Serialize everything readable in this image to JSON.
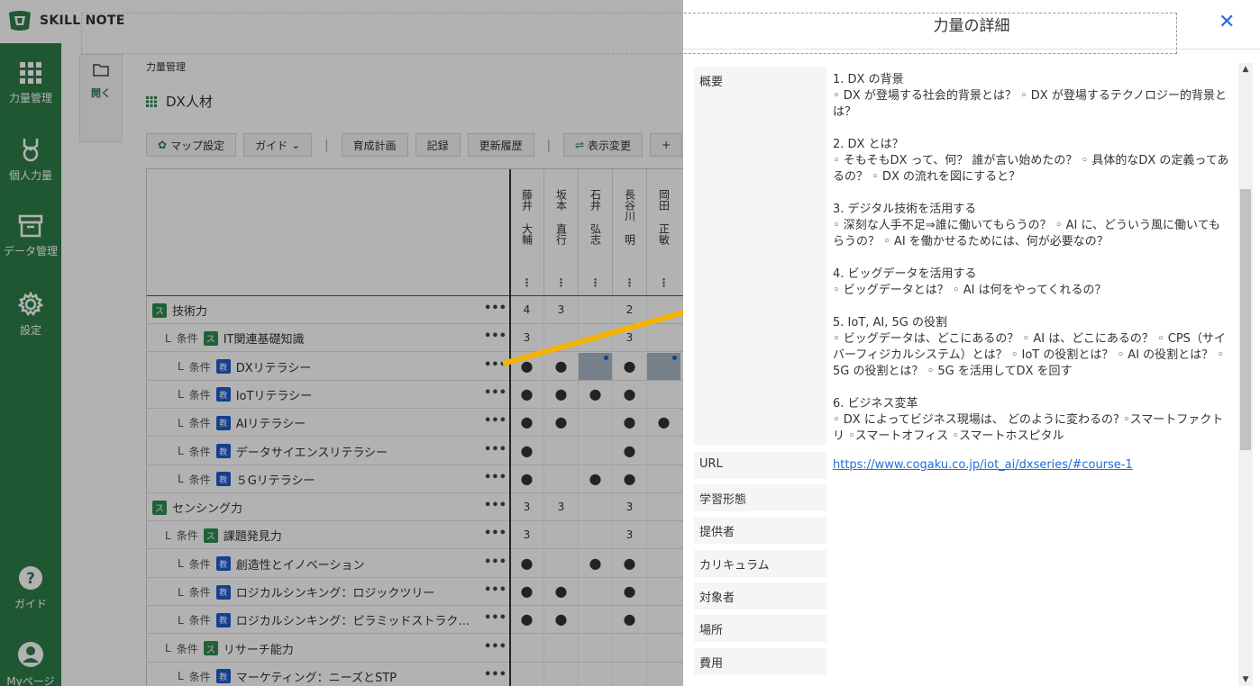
{
  "app": {
    "logo_text": "SKILL NOTE"
  },
  "sidenav": {
    "items": [
      {
        "label": "力量管理",
        "icon": "grid-icon"
      },
      {
        "label": "個人力量",
        "icon": "medal-icon"
      },
      {
        "label": "データ管理",
        "icon": "archive-icon"
      },
      {
        "label": "設定",
        "icon": "gear-icon"
      }
    ],
    "bottom": [
      {
        "label": "ガイド",
        "icon": "help-icon"
      },
      {
        "label": "Myページ",
        "icon": "user-icon"
      }
    ]
  },
  "main": {
    "open_label": "開く",
    "breadcrumb": "力量管理",
    "title": "DX人材",
    "toolbar": {
      "map_settings": "マップ設定",
      "guide": "ガイド",
      "training_plan": "育成計画",
      "record": "記録",
      "history": "更新履歴",
      "display_change": "表示変更",
      "separator": "|"
    },
    "people": [
      {
        "name": "藤井 大輔"
      },
      {
        "name": "坂本 直行"
      },
      {
        "name": "石井 弘志"
      },
      {
        "name": "長谷川 明"
      },
      {
        "name": "岡田 正敏"
      }
    ],
    "rows": [
      {
        "depth": 0,
        "prefix": "",
        "cond": "",
        "badge": "ス",
        "badge_type": "s",
        "label": "技術力",
        "cells": [
          "4",
          "3",
          "",
          "2",
          ""
        ]
      },
      {
        "depth": 1,
        "prefix": "L",
        "cond": "条件",
        "badge": "ス",
        "badge_type": "s",
        "label": "IT関連基礎知識",
        "cells": [
          "3",
          "",
          "",
          "3",
          ""
        ]
      },
      {
        "depth": 2,
        "prefix": "L",
        "cond": "条件",
        "badge": "教",
        "badge_type": "k",
        "label": "DXリテラシー",
        "cells": [
          "●",
          "●",
          "",
          "●",
          ""
        ]
      },
      {
        "depth": 2,
        "prefix": "L",
        "cond": "条件",
        "badge": "教",
        "badge_type": "k",
        "label": "IoTリテラシー",
        "cells": [
          "●",
          "●",
          "●",
          "●",
          ""
        ]
      },
      {
        "depth": 2,
        "prefix": "L",
        "cond": "条件",
        "badge": "教",
        "badge_type": "k",
        "label": "AIリテラシー",
        "cells": [
          "●",
          "●",
          "",
          "●",
          "●"
        ]
      },
      {
        "depth": 2,
        "prefix": "L",
        "cond": "条件",
        "badge": "教",
        "badge_type": "k",
        "label": "データサイエンスリテラシー",
        "cells": [
          "●",
          "",
          "",
          "●",
          ""
        ]
      },
      {
        "depth": 2,
        "prefix": "L",
        "cond": "条件",
        "badge": "教",
        "badge_type": "k",
        "label": "５Gリテラシー",
        "cells": [
          "●",
          "",
          "●",
          "●",
          ""
        ]
      },
      {
        "depth": 0,
        "prefix": "",
        "cond": "",
        "badge": "ス",
        "badge_type": "s",
        "label": "センシング力",
        "cells": [
          "3",
          "3",
          "",
          "3",
          ""
        ]
      },
      {
        "depth": 1,
        "prefix": "L",
        "cond": "条件",
        "badge": "ス",
        "badge_type": "s",
        "label": "課題発見力",
        "cells": [
          "3",
          "",
          "",
          "3",
          ""
        ]
      },
      {
        "depth": 2,
        "prefix": "L",
        "cond": "条件",
        "badge": "教",
        "badge_type": "k",
        "label": "創造性とイノベーション",
        "cells": [
          "●",
          "",
          "●",
          "●",
          ""
        ]
      },
      {
        "depth": 2,
        "prefix": "L",
        "cond": "条件",
        "badge": "教",
        "badge_type": "k",
        "label": "ロジカルシンキング：ロジックツリー",
        "cells": [
          "●",
          "●",
          "",
          "●",
          ""
        ]
      },
      {
        "depth": 2,
        "prefix": "L",
        "cond": "条件",
        "badge": "教",
        "badge_type": "k",
        "label": "ロジカルシンキング：ピラミッドストラク…",
        "cells": [
          "●",
          "●",
          "",
          "●",
          ""
        ]
      },
      {
        "depth": 1,
        "prefix": "L",
        "cond": "条件",
        "badge": "ス",
        "badge_type": "s",
        "label": "リサーチ能力",
        "cells": [
          "",
          "",
          "",
          "",
          ""
        ]
      },
      {
        "depth": 2,
        "prefix": "L",
        "cond": "条件",
        "badge": "教",
        "badge_type": "k",
        "label": "マーケティング：ニーズとSTP",
        "cells": [
          "",
          "",
          "",
          "",
          ""
        ]
      }
    ],
    "more": "•••",
    "col_menu": "⋮"
  },
  "drawer": {
    "title": "力量の詳細",
    "close": "✕",
    "fields": [
      {
        "key": "概要",
        "lines": [
          "1. DX の背景",
          "◦ DX が登場する社会的背景とは？ ◦ DX が登場するテクノロジー的背景とは？",
          "",
          "2. DX とは？",
          "◦ そもそもDX って、何？ 誰が言い始めたの？ ◦ 具体的なDX の定義ってあるの？ ◦ DX の流れを図にすると？",
          "",
          "3. デジタル技術を活用する",
          "◦ 深刻な人手不足⇒誰に働いてもらうの？ ◦ AI に、どういう風に働いてもらうの？ ◦ AI を働かせるためには、何が必要なの？",
          "",
          "4. ビッグデータを活用する",
          "◦ ビッグデータとは？ ◦ AI は何をやってくれるの？",
          "",
          "5. IoT, AI, 5G の役割",
          "◦ ビッグデータは、どこにあるの？ ◦ AI は、どこにあるの？ ◦ CPS（サイバーフィジカルシステム）とは？ ◦ IoT の役割とは？ ◦ AI の役割とは？ ◦ 5G の役割とは？ ◦ 5G を活用してDX を回す",
          "",
          "6. ビジネス変革",
          "◦ DX によってビジネス現場は、 どのように変わるの? ◦スマートファクトリ ◦スマートオフィス ◦スマートホスピタル"
        ]
      },
      {
        "key": "URL",
        "value": "https://www.cogaku.co.jp/iot_ai/dxseries/#course-1"
      },
      {
        "key": "学習形態",
        "value": ""
      },
      {
        "key": "提供者",
        "value": ""
      },
      {
        "key": "カリキュラム",
        "value": ""
      },
      {
        "key": "対象者",
        "value": ""
      },
      {
        "key": "場所",
        "value": ""
      },
      {
        "key": "費用",
        "value": ""
      }
    ]
  },
  "colors": {
    "brand": "#2e7d4a",
    "accent": "#1e6fd9",
    "arrow": "#f5b400"
  }
}
